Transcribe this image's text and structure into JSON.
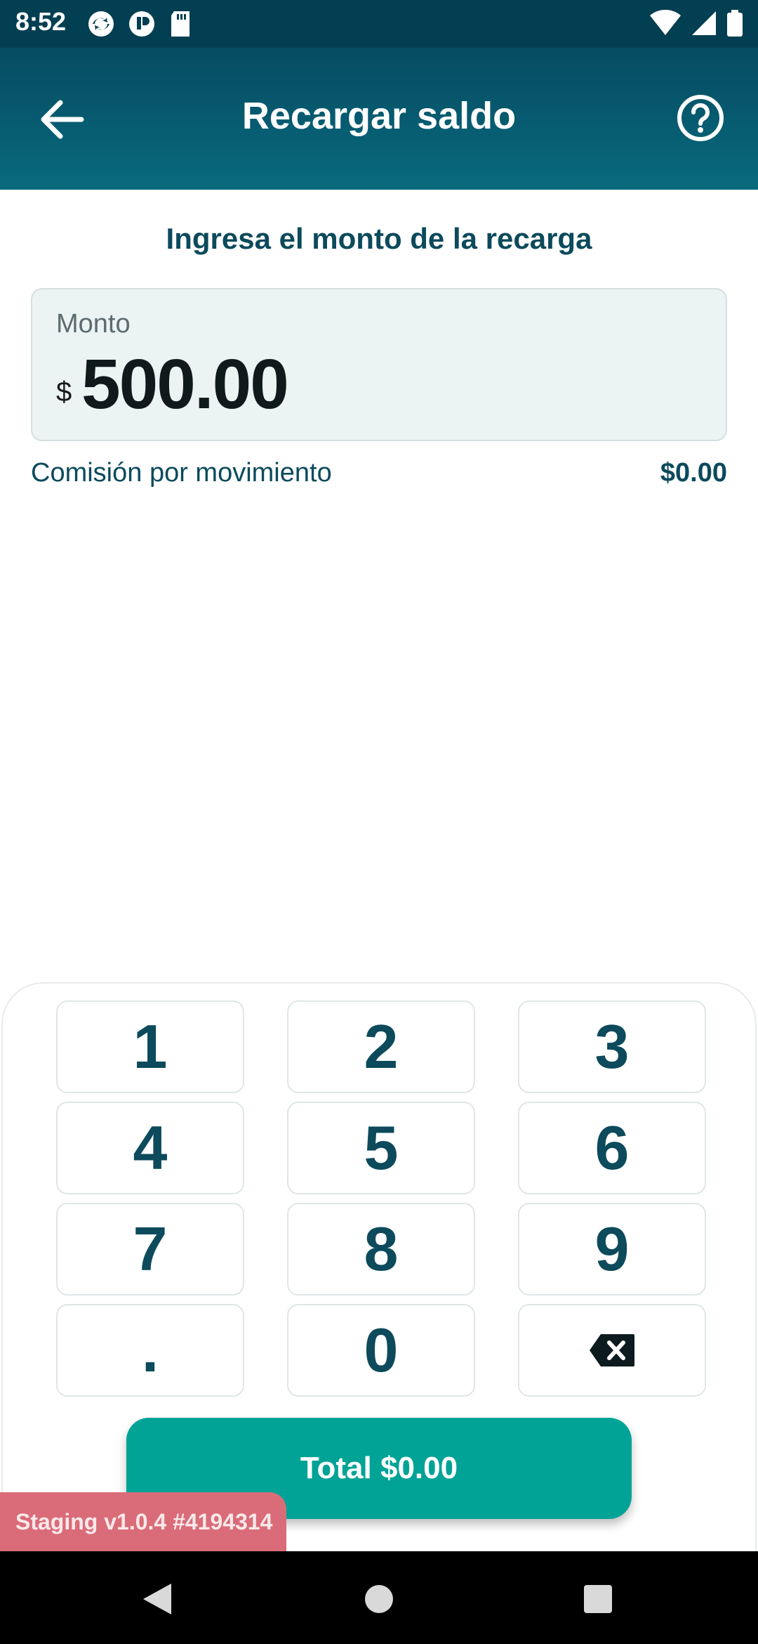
{
  "status_bar": {
    "time": "8:52"
  },
  "app_bar": {
    "title": "Recargar saldo"
  },
  "main": {
    "subtitle": "Ingresa el monto de la recarga",
    "amount_field": {
      "label": "Monto",
      "currency": "$",
      "value": "500.00"
    },
    "fee": {
      "label": "Comisión por movimiento",
      "value": "$0.00"
    }
  },
  "keypad": {
    "keys": [
      "1",
      "2",
      "3",
      "4",
      "5",
      "6",
      "7",
      "8",
      "9",
      ".",
      "0"
    ]
  },
  "total_button": {
    "label": "Total $0.00"
  },
  "staging_badge": {
    "text": "Staging v1.0.4 #4194314"
  },
  "colors": {
    "header": "#086a7e",
    "accent": "#00a396",
    "text": "#0c4a5c",
    "badge": "#d96c78"
  }
}
